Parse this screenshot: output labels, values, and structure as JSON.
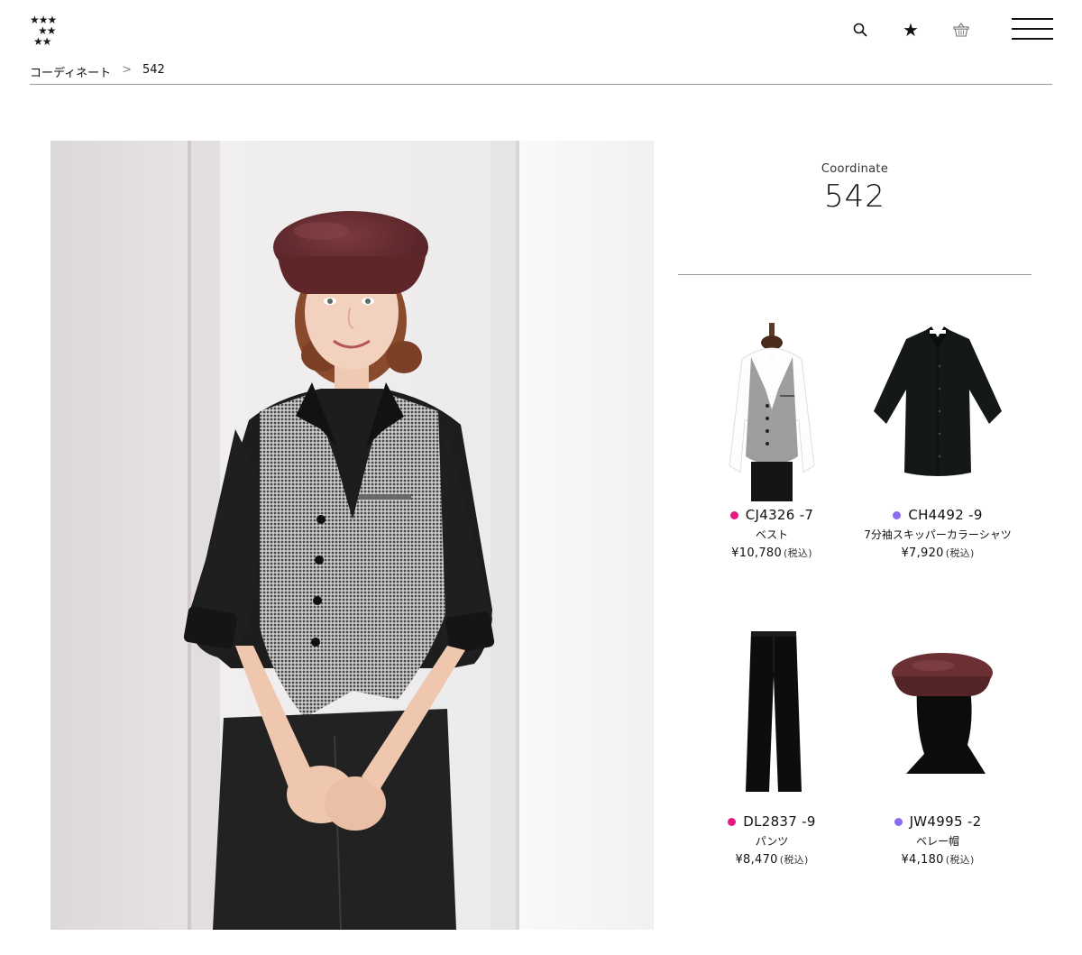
{
  "header": {
    "logo_glyph": "★",
    "icons": [
      "search-icon",
      "star-icon",
      "basket-icon",
      "hamburger-menu-icon"
    ],
    "favorite_glyph": "★"
  },
  "breadcrumb": {
    "parent": "コーディネート",
    "separator": ">",
    "current": "542"
  },
  "coordinate": {
    "label": "Coordinate",
    "number": "542"
  },
  "products": [
    {
      "code": "CJ4326 -7",
      "name": "ベスト",
      "price": "¥10,780",
      "tax": "(税込)",
      "dot_color": "#e6197f"
    },
    {
      "code": "CH4492 -9",
      "name": "7分袖スキッパーカラーシャツ",
      "price": "¥7,920",
      "tax": "(税込)",
      "dot_color": "#8b6cf0"
    },
    {
      "code": "DL2837 -9",
      "name": "パンツ",
      "price": "¥8,470",
      "tax": "(税込)",
      "dot_color": "#e6197f"
    },
    {
      "code": "JW4995 -2",
      "name": "ベレー帽",
      "price": "¥4,180",
      "tax": "(税込)",
      "dot_color": "#8b6cf0"
    }
  ],
  "colors": {
    "beret": "#6b2c30",
    "vest": "#8e8e8e",
    "shirt": "#1c1c1c",
    "background_wall": "#e9e7e8"
  }
}
